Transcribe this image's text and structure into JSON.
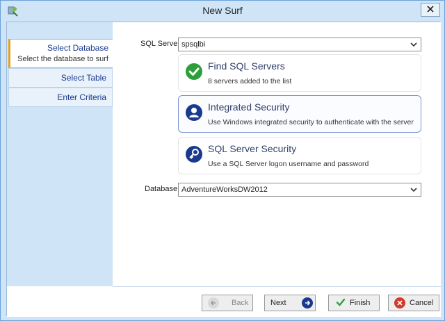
{
  "window": {
    "title": "New Surf"
  },
  "steps": [
    {
      "label": "Select Database",
      "description": "Select the database to surf"
    },
    {
      "label": "Select Table"
    },
    {
      "label": "Enter Criteria"
    }
  ],
  "form": {
    "sql_server_label": "SQL Server:",
    "sql_server_value": "spsqlbi",
    "database_label": "Database:",
    "database_value": "AdventureWorksDW2012"
  },
  "cards": [
    {
      "title": "Find SQL Servers",
      "description": "8 servers added to the list",
      "icon": "check-icon"
    },
    {
      "title": "Integrated Security",
      "description": "Use Windows integrated security to authenticate with the server",
      "icon": "user-icon"
    },
    {
      "title": "SQL Server Security",
      "description": "Use a SQL Server logon username and password",
      "icon": "key-icon"
    }
  ],
  "buttons": {
    "back": "Back",
    "next": "Next",
    "finish": "Finish",
    "cancel": "Cancel"
  },
  "colors": {
    "chrome": "#cfe4f7",
    "accent": "#1a3a8f",
    "success": "#2e9e3a",
    "danger": "#d23a2a"
  }
}
